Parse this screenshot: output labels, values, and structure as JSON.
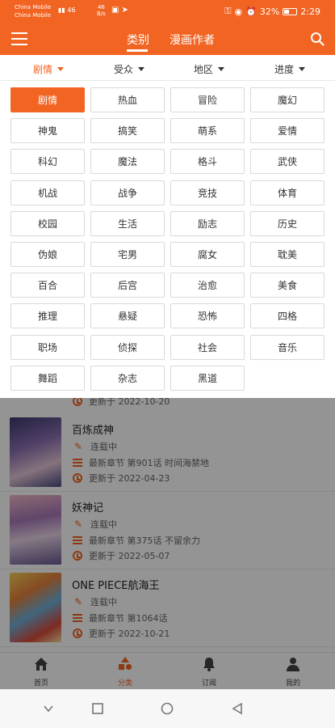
{
  "status_bar": {
    "carrier1": "China Mobile",
    "carrier2": "China Mobile",
    "signal": "46",
    "net_speed_value": "46",
    "net_speed_unit": "B/s",
    "battery": "32%",
    "time": "2:29"
  },
  "appbar": {
    "tab_category": "类别",
    "tab_authors": "漫画作者"
  },
  "filters": [
    {
      "label": "剧情",
      "active": true
    },
    {
      "label": "受众",
      "active": false
    },
    {
      "label": "地区",
      "active": false
    },
    {
      "label": "进度",
      "active": false
    }
  ],
  "genres": [
    "剧情",
    "热血",
    "冒险",
    "魔幻",
    "神鬼",
    "搞笑",
    "萌系",
    "爱情",
    "科幻",
    "魔法",
    "格斗",
    "武侠",
    "机战",
    "战争",
    "竞技",
    "体育",
    "校园",
    "生活",
    "励志",
    "历史",
    "伪娘",
    "宅男",
    "腐女",
    "耽美",
    "百合",
    "后宫",
    "治愈",
    "美食",
    "推理",
    "悬疑",
    "恐怖",
    "四格",
    "职场",
    "侦探",
    "社会",
    "音乐",
    "舞蹈",
    "杂志",
    "黑道"
  ],
  "selected_genre": "剧情",
  "list": {
    "partial_update": "更新于 2022-10-20",
    "items": [
      {
        "title": "百炼成神",
        "status": "连载中",
        "latest": "最新章节 第901话 时间海禁地",
        "updated": "更新于 2022-04-23"
      },
      {
        "title": "妖神记",
        "status": "连载中",
        "latest": "最新章节 第375话 不留余力",
        "updated": "更新于 2022-05-07"
      },
      {
        "title": "ONE PIECE航海王",
        "status": "连载中",
        "latest": "最新章节 第1064话",
        "updated": "更新于 2022-10-21"
      }
    ]
  },
  "bottom_nav": {
    "home": "首页",
    "category": "分类",
    "subscribe": "订阅",
    "mine": "我的"
  },
  "colors": {
    "accent": "#f26422"
  }
}
